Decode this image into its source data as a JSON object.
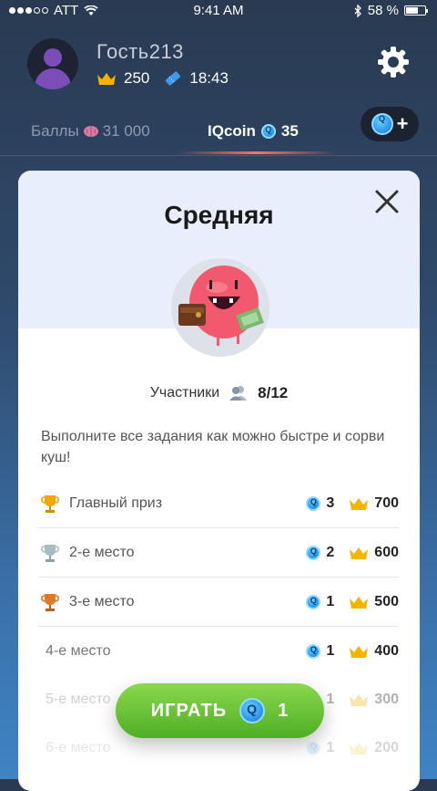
{
  "status": {
    "carrier": "ATT",
    "time": "9:41 AM",
    "battery": "58 %",
    "battery_level": 0.58
  },
  "profile": {
    "username": "Гость213",
    "crowns": "250",
    "timer": "18:43"
  },
  "tabs": {
    "points_label": "Баллы",
    "points_value": "31 000",
    "iqcoin_label": "IQcoin",
    "iqcoin_value": "35"
  },
  "add_coin_label": "+",
  "card": {
    "title": "Средняя",
    "participants_label": "Участники",
    "participants_count": "8/12",
    "description": "Выполните все задания как можно быстре и сорви куш!"
  },
  "prizes": [
    {
      "label": "Главный приз",
      "coins": "3",
      "crowns": "700",
      "trophy": "gold-trophy-icon"
    },
    {
      "label": "2-е место",
      "coins": "2",
      "crowns": "600",
      "trophy": "silver-trophy-icon"
    },
    {
      "label": "3-е место",
      "coins": "1",
      "crowns": "500",
      "trophy": "bronze-trophy-icon"
    },
    {
      "label": "4-е место",
      "coins": "1",
      "crowns": "400"
    },
    {
      "label": "5-е место",
      "coins": "1",
      "crowns": "300"
    },
    {
      "label": "6-е место",
      "coins": "1",
      "crowns": "200"
    }
  ],
  "play_button": {
    "label": "ИГРАТЬ",
    "cost": "1"
  },
  "colors": {
    "accent_green": "#5cbf2a",
    "coin_blue": "#1a8fe8",
    "crown_gold": "#f4b400"
  }
}
